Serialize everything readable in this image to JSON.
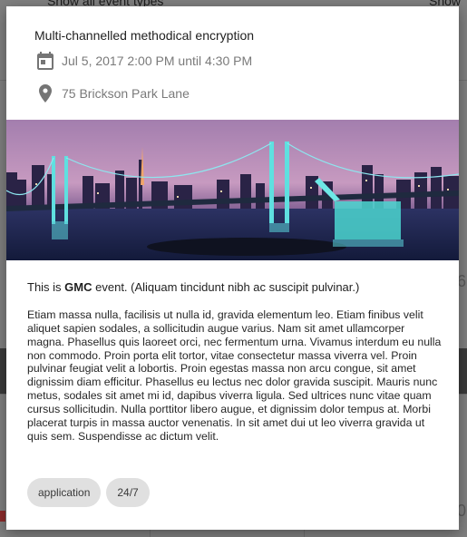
{
  "background": {
    "top_left_text": "Show all event types",
    "top_right_text": "Show",
    "right_digit": "6",
    "right_digit_2": "0"
  },
  "event": {
    "title": "Multi-channelled methodical encryption",
    "date_range": "Jul 5, 2017 2:00 PM until 4:30 PM",
    "location": "75 Brickson Park Lane",
    "date_icon": "calendar-icon",
    "location_icon": "map-pin-icon",
    "image_subject": "night city skyline with illuminated suspension bridge",
    "summary_prefix": "This is ",
    "summary_org": "GMC",
    "summary_suffix": " event. (Aliquam tincidunt nibh ac suscipit pulvinar.)",
    "description": "Etiam massa nulla, facilisis ut nulla id, gravida elementum leo. Etiam finibus velit aliquet sapien sodales, a sollicitudin augue varius. Nam sit amet ullamcorper magna. Phasellus quis laoreet orci, nec fermentum urna. Vivamus interdum eu nulla non commodo. Proin porta elit tortor, vitae consectetur massa viverra vel. Proin pulvinar feugiat velit a lobortis. Proin egestas massa non arcu congue, sit amet dignissim diam efficitur. Phasellus eu lectus nec dolor gravida suscipit. Mauris nunc metus, sodales sit amet mi id, dapibus viverra ligula. Sed ultrices nunc vitae quam cursus sollicitudin. Nulla porttitor libero augue, et dignissim dolor tempus at. Morbi placerat turpis in massa auctor venenatis. In sit amet dui ut leo viverra gravida ut quis sem. Suspendisse ac dictum velit.",
    "tags": [
      "application",
      "24/7"
    ]
  },
  "colors": {
    "icon_gray": "#757575",
    "chip_bg": "#e0e0e0",
    "backdrop": "#7f7f7f"
  }
}
